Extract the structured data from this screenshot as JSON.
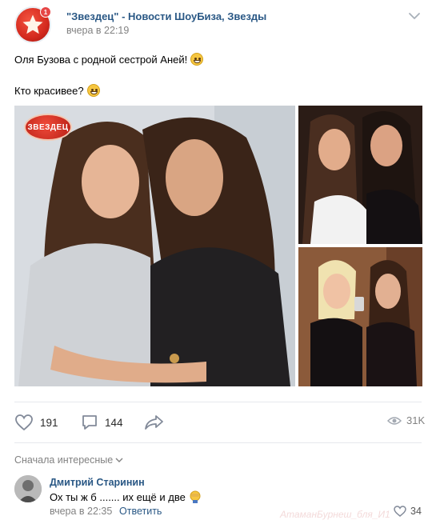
{
  "post": {
    "author": "\"Звездец\" - Новости ШоуБиза, Звезды",
    "time": "вчера в 22:19",
    "avatar_badge": "1",
    "text_lines": [
      "Оля Бузова с родной сестрой Аней!",
      "Кто красивее?"
    ],
    "photo_logo": "ЗВЕЗДЕЦ",
    "likes": "191",
    "comments": "144",
    "views": "31K"
  },
  "comments_section": {
    "sort_label": "Сначала интересные",
    "comment": {
      "author": "Дмитрий Старинин",
      "text": "Ох ты ж б ....... их ещё и две",
      "time": "вчера в 22:35",
      "reply_label": "Ответить",
      "likes": "34"
    }
  },
  "watermark": "АтаманБурнеш_бля_И1",
  "icons": {
    "like": "heart-icon",
    "comment": "comment-icon",
    "share": "share-icon",
    "views": "eye-icon",
    "menu": "chevron-down-icon"
  },
  "colors": {
    "link": "#2a5885",
    "muted": "#828282",
    "brand_red": "#d42a1e"
  }
}
